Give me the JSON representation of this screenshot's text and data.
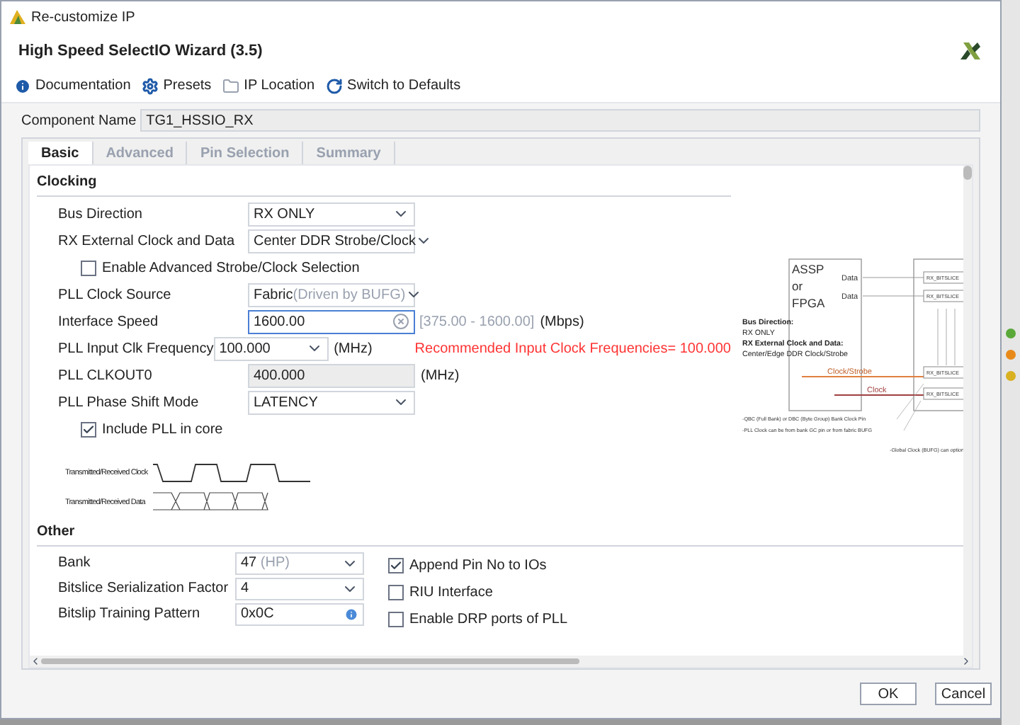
{
  "window": {
    "title": "Re-customize IP"
  },
  "header": {
    "title": "High Speed SelectIO Wizard (3.5)"
  },
  "toolbar": [
    {
      "kind": "info",
      "label": "Documentation"
    },
    {
      "kind": "gear",
      "label": "Presets"
    },
    {
      "kind": "folder",
      "label": "IP Location"
    },
    {
      "kind": "reset",
      "label": "Switch to Defaults"
    }
  ],
  "component_name": {
    "label": "Component Name",
    "value": "TG1_HSSIO_RX"
  },
  "tabs": [
    {
      "label": "Basic",
      "selected": true
    },
    {
      "label": "Advanced",
      "selected": false
    },
    {
      "label": "Pin Selection",
      "selected": false
    },
    {
      "label": "Summary",
      "selected": false
    }
  ],
  "clocking": {
    "title": "Clocking",
    "rows": [
      {
        "kind": "select",
        "label": "Bus Direction",
        "value": "RX ONLY"
      },
      {
        "kind": "select",
        "label": "RX External Clock and Data",
        "value": "Center DDR Strobe/Clock"
      },
      {
        "kind": "checkbox",
        "label": "Enable Advanced Strobe/Clock Selection",
        "checked": false
      },
      {
        "kind": "select",
        "label": "PLL Clock Source",
        "value": "Fabric",
        "hint": "(Driven by BUFG)"
      },
      {
        "kind": "input",
        "label": "Interface Speed",
        "value": "1600.00",
        "range": "[375.00 - 1600.00]",
        "unit": "(Mbps)",
        "focused": true
      },
      {
        "kind": "select",
        "label": "PLL Input Clk Frequency",
        "value": "100.000",
        "unit": "(MHz)",
        "note": "Recommended Input Clock Frequencies= 100.000"
      },
      {
        "kind": "readonly",
        "label": "PLL CLKOUT0",
        "value": "400.000",
        "unit": "(MHz)"
      },
      {
        "kind": "select",
        "label": "PLL Phase Shift Mode",
        "value": "LATENCY"
      },
      {
        "kind": "checkbox",
        "label": "Include PLL in core",
        "checked": true
      }
    ]
  },
  "waveform": {
    "clock_label": "Transmitted/Received Clock",
    "data_label": "Transmitted/Received Data"
  },
  "diagram": {
    "device": [
      "ASSP",
      "or",
      "FPGA"
    ],
    "data_lines": [
      "Data",
      "Data"
    ],
    "description": [
      {
        "text": "Bus Direction:",
        "bold": true
      },
      {
        "text": "RX ONLY",
        "bold": false
      },
      {
        "text": "RX External Clock and Data:",
        "bold": true
      },
      {
        "text": "Center/Edge DDR Clock/Strobe",
        "bold": false
      }
    ],
    "strobe_label": "Clock/Strobe",
    "clock_label": "Clock",
    "slice_labels": [
      "RX_BITSLICE",
      "RX_BITSLICE",
      "RX_BITSLICE",
      "RX_BITSLICE"
    ],
    "notes": [
      "-QBC (Full Bank) or DBC (Byte Group) Bank Clock Pin",
      "-PLL Clock can be from bank GC pin or from fabric BUFG"
    ],
    "side_note": "-Global Clock (BUFG) can option"
  },
  "other": {
    "title": "Other",
    "fields": [
      {
        "kind": "select",
        "label": "Bank",
        "value": "47",
        "hint": "(HP)"
      },
      {
        "kind": "select",
        "label": "Bitslice Serialization Factor",
        "value": "4"
      },
      {
        "kind": "info",
        "label": "Bitslip Training Pattern",
        "value": "0x0C"
      }
    ],
    "options": [
      {
        "label": "Append Pin No to IOs",
        "checked": true
      },
      {
        "label": "RIU Interface",
        "checked": false
      },
      {
        "label": "Enable DRP ports of PLL",
        "checked": false
      }
    ]
  },
  "buttons": [
    {
      "label": "OK"
    },
    {
      "label": "Cancel"
    }
  ]
}
